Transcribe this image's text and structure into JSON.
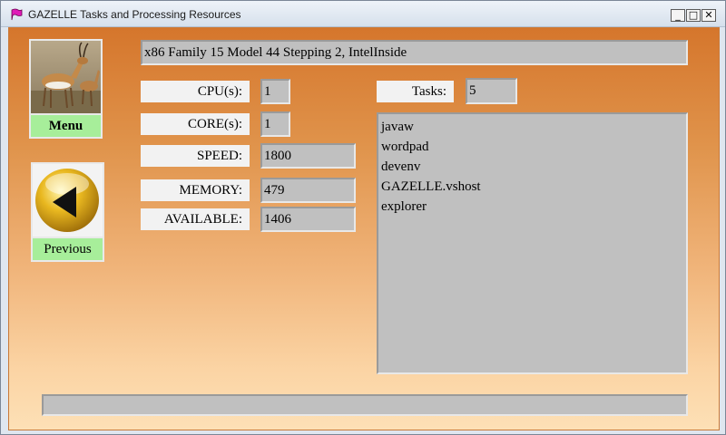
{
  "window": {
    "title": "GAZELLE Tasks and Processing Resources"
  },
  "titlebar_buttons": {
    "minimize": "_",
    "maximize": "□",
    "close": "✕"
  },
  "nav": {
    "menu_label": "Menu",
    "previous_label": "Previous"
  },
  "cpu_description": "x86 Family 15 Model 44 Stepping 2, IntelInside",
  "fields": {
    "cpus_label": "CPU(s):",
    "cpus_value": "1",
    "cores_label": "CORE(s):",
    "cores_value": "1",
    "speed_label": "SPEED:",
    "speed_value": "1800",
    "memory_label": "MEMORY:",
    "memory_value": "479",
    "available_label": "AVAILABLE:",
    "available_value": "1406",
    "tasks_label": "Tasks:",
    "tasks_value": "5"
  },
  "tasks": [
    "javaw",
    "wordpad",
    "devenv",
    "GAZELLE.vshost",
    "explorer"
  ],
  "status_bar": "",
  "colors": {
    "gradient_top": "#d5762c",
    "gradient_bottom": "#fde0b6",
    "nav_green": "#a7ee9a",
    "field_gray": "#c0c0c0"
  }
}
